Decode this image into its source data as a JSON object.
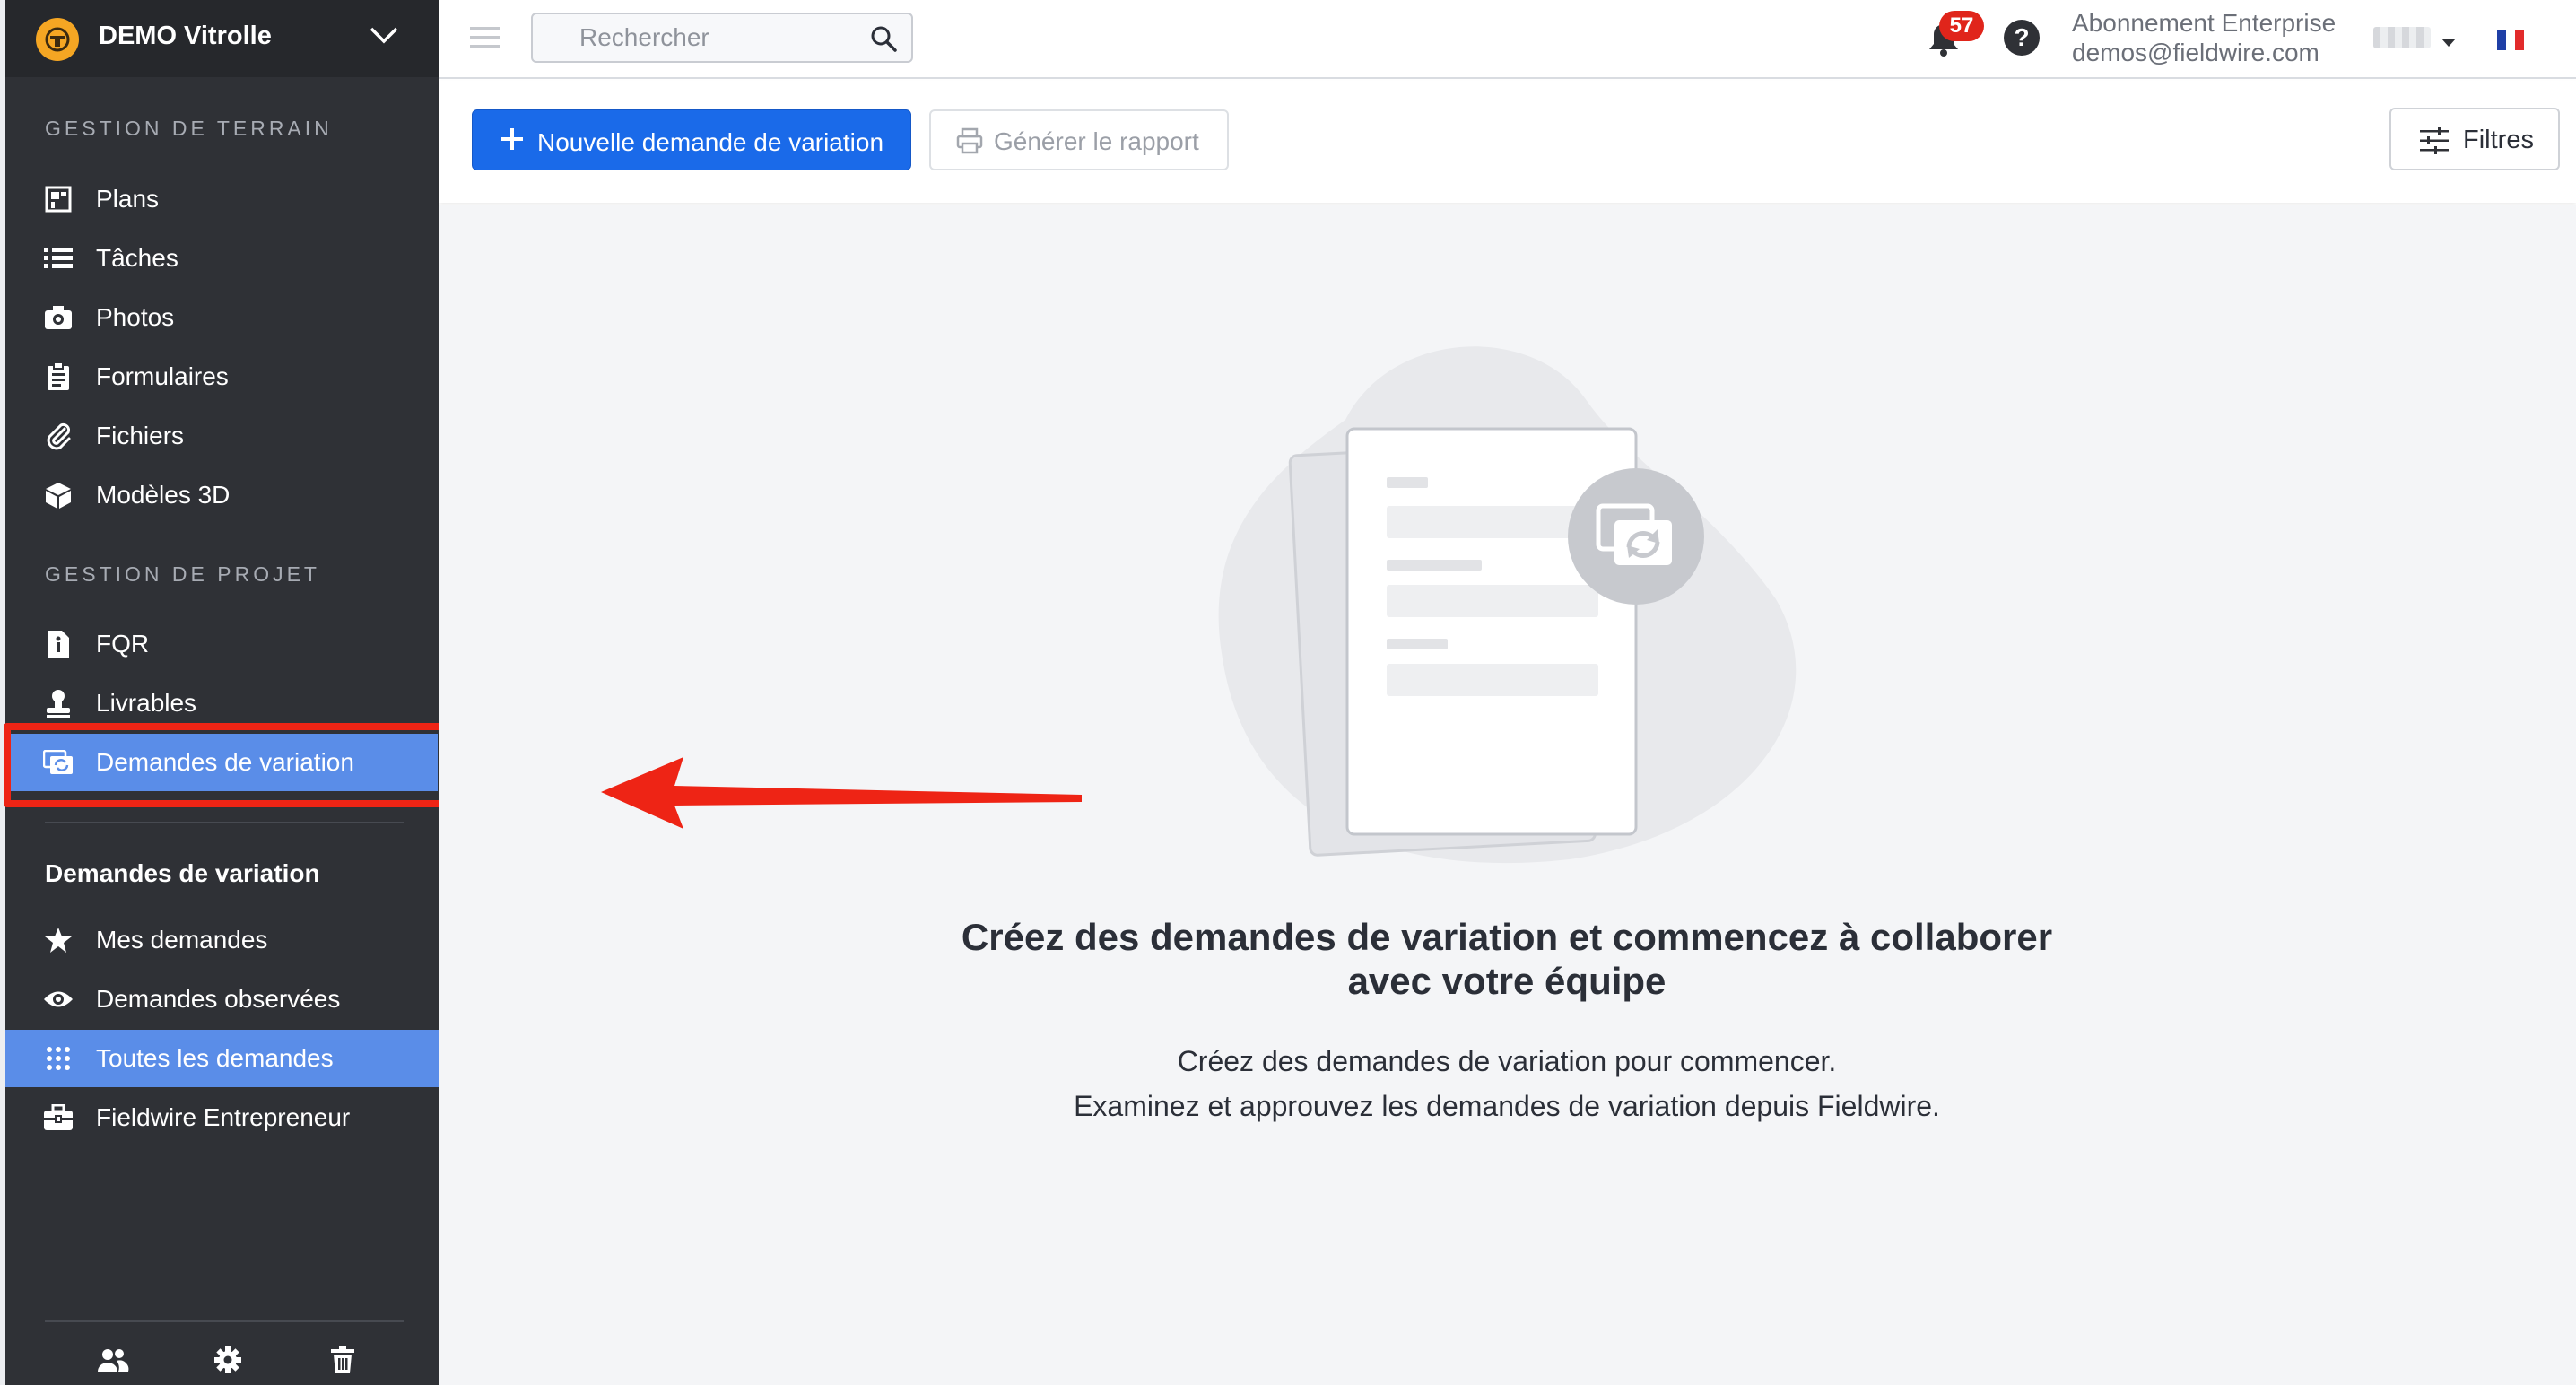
{
  "project": {
    "name": "DEMO Vitrolle"
  },
  "sidebar": {
    "section_field": "GESTION DE TERRAIN",
    "field_items": [
      {
        "label": "Plans",
        "icon": "plans-icon"
      },
      {
        "label": "Tâches",
        "icon": "list-icon"
      },
      {
        "label": "Photos",
        "icon": "camera-icon"
      },
      {
        "label": "Formulaires",
        "icon": "clipboard-icon"
      },
      {
        "label": "Fichiers",
        "icon": "paperclip-icon"
      },
      {
        "label": "Modèles 3D",
        "icon": "cube-icon"
      }
    ],
    "section_project": "GESTION DE PROJET",
    "project_items": [
      {
        "label": "FQR",
        "icon": "document-info-icon"
      },
      {
        "label": "Livrables",
        "icon": "stamp-icon"
      },
      {
        "label": "Demandes de variation",
        "icon": "change-order-icon",
        "active": true
      }
    ],
    "sub_title": "Demandes de variation",
    "sub_items": [
      {
        "label": "Mes demandes",
        "icon": "star-icon"
      },
      {
        "label": "Demandes observées",
        "icon": "eye-icon"
      },
      {
        "label": "Toutes les demandes",
        "icon": "grid-dots-icon",
        "active": true
      },
      {
        "label": "Fieldwire Entrepreneur",
        "icon": "briefcase-icon"
      }
    ],
    "footer_icons": [
      "users-icon",
      "gear-icon",
      "trash-icon"
    ]
  },
  "topbar": {
    "search_placeholder": "Rechercher",
    "notification_count": "57",
    "help_label": "?",
    "plan_name": "Abonnement Enterprise",
    "email": "demos@fieldwire.com"
  },
  "toolbar": {
    "new_button": "Nouvelle demande de variation",
    "report_button": "Générer le rapport",
    "filters_button": "Filtres"
  },
  "empty_state": {
    "title": "Créez des demandes de variation et commencez à collaborer avec votre équipe",
    "line1": "Créez des demandes de variation pour commencer.",
    "line2": "Examinez et approuvez les demandes de variation depuis Fieldwire."
  },
  "colors": {
    "primary": "#1a6ae9",
    "sidebar_bg": "#2f3136",
    "active_item": "#5a8de8",
    "highlight": "#ee2415",
    "badge": "#e0251b"
  }
}
